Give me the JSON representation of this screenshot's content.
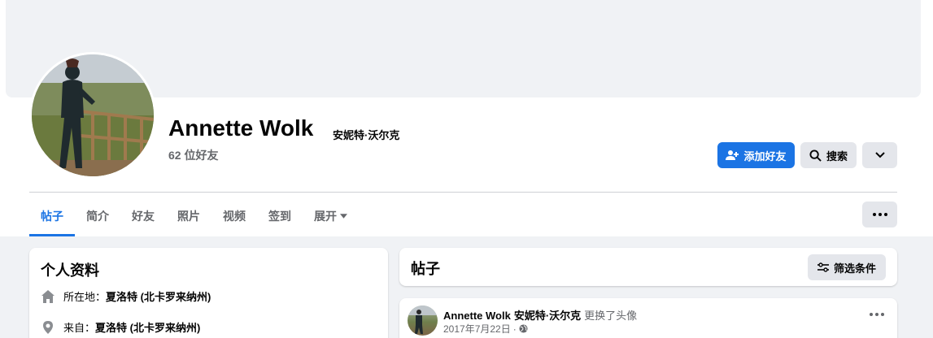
{
  "profile": {
    "name": "Annette Wolk",
    "alt_name": "安妮特·沃尔克",
    "friends": "62 位好友"
  },
  "actions": {
    "add_friend": "添加好友",
    "search": "搜索"
  },
  "tabs": [
    {
      "label": "帖子",
      "active": true
    },
    {
      "label": "简介"
    },
    {
      "label": "好友"
    },
    {
      "label": "照片"
    },
    {
      "label": "视频"
    },
    {
      "label": "签到"
    },
    {
      "label": "展开"
    }
  ],
  "intro": {
    "title": "个人资料",
    "lives_label": "所在地：",
    "lives_value": "夏洛特 (北卡罗来纳州)",
    "from_label": "来自：",
    "from_value": "夏洛特 (北卡罗来纳州)"
  },
  "posts_section": {
    "title": "帖子",
    "filter": "筛选条件"
  },
  "post": {
    "author": "Annette Wolk",
    "author_alt": "安妮特·沃尔克",
    "action": "更换了头像",
    "date": "2017年7月22日",
    "separator": "·"
  },
  "colors": {
    "accent": "#1b74e4",
    "secondary_button": "#e4e6eb",
    "page_bg": "#f0f2f5",
    "muted_text": "#65676b"
  }
}
